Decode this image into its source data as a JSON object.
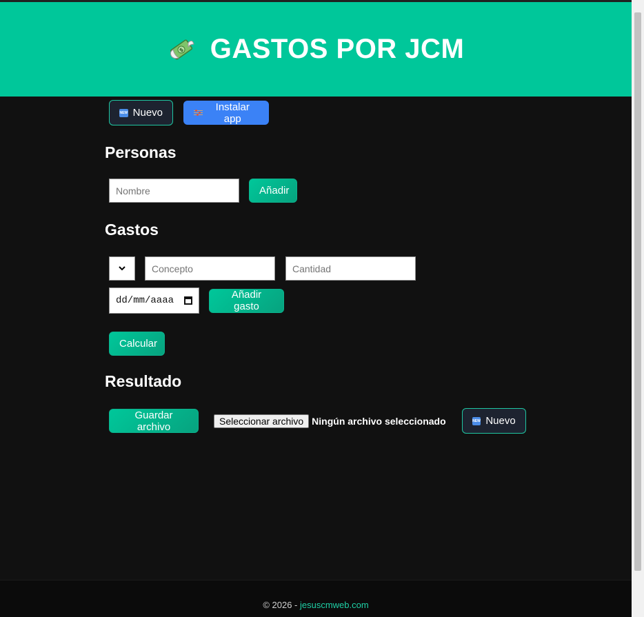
{
  "header": {
    "title": "GASTOS POR JCM",
    "icon": "money-with-wings-icon"
  },
  "toolbar": {
    "new_label": "Nuevo",
    "install_label": "Instalar app"
  },
  "personas": {
    "heading": "Personas",
    "name_placeholder": "Nombre",
    "add_label": "Añadir"
  },
  "gastos": {
    "heading": "Gastos",
    "concept_placeholder": "Concepto",
    "amount_placeholder": "Cantidad",
    "date_placeholder": "dd/mm/aaaa",
    "add_label": "Añadir gasto",
    "calc_label": "Calcular"
  },
  "resultado": {
    "heading": "Resultado",
    "save_label": "Guardar archivo",
    "choose_file_label": "Seleccionar archivo",
    "no_file_label": "Ningún archivo seleccionado",
    "new_label": "Nuevo"
  },
  "footer": {
    "copyright": "© 2026 - ",
    "link_text": "jesuscmweb.com"
  },
  "colors": {
    "accent": "#00c79a",
    "background": "#111111",
    "install_button": "#3b82f6"
  }
}
